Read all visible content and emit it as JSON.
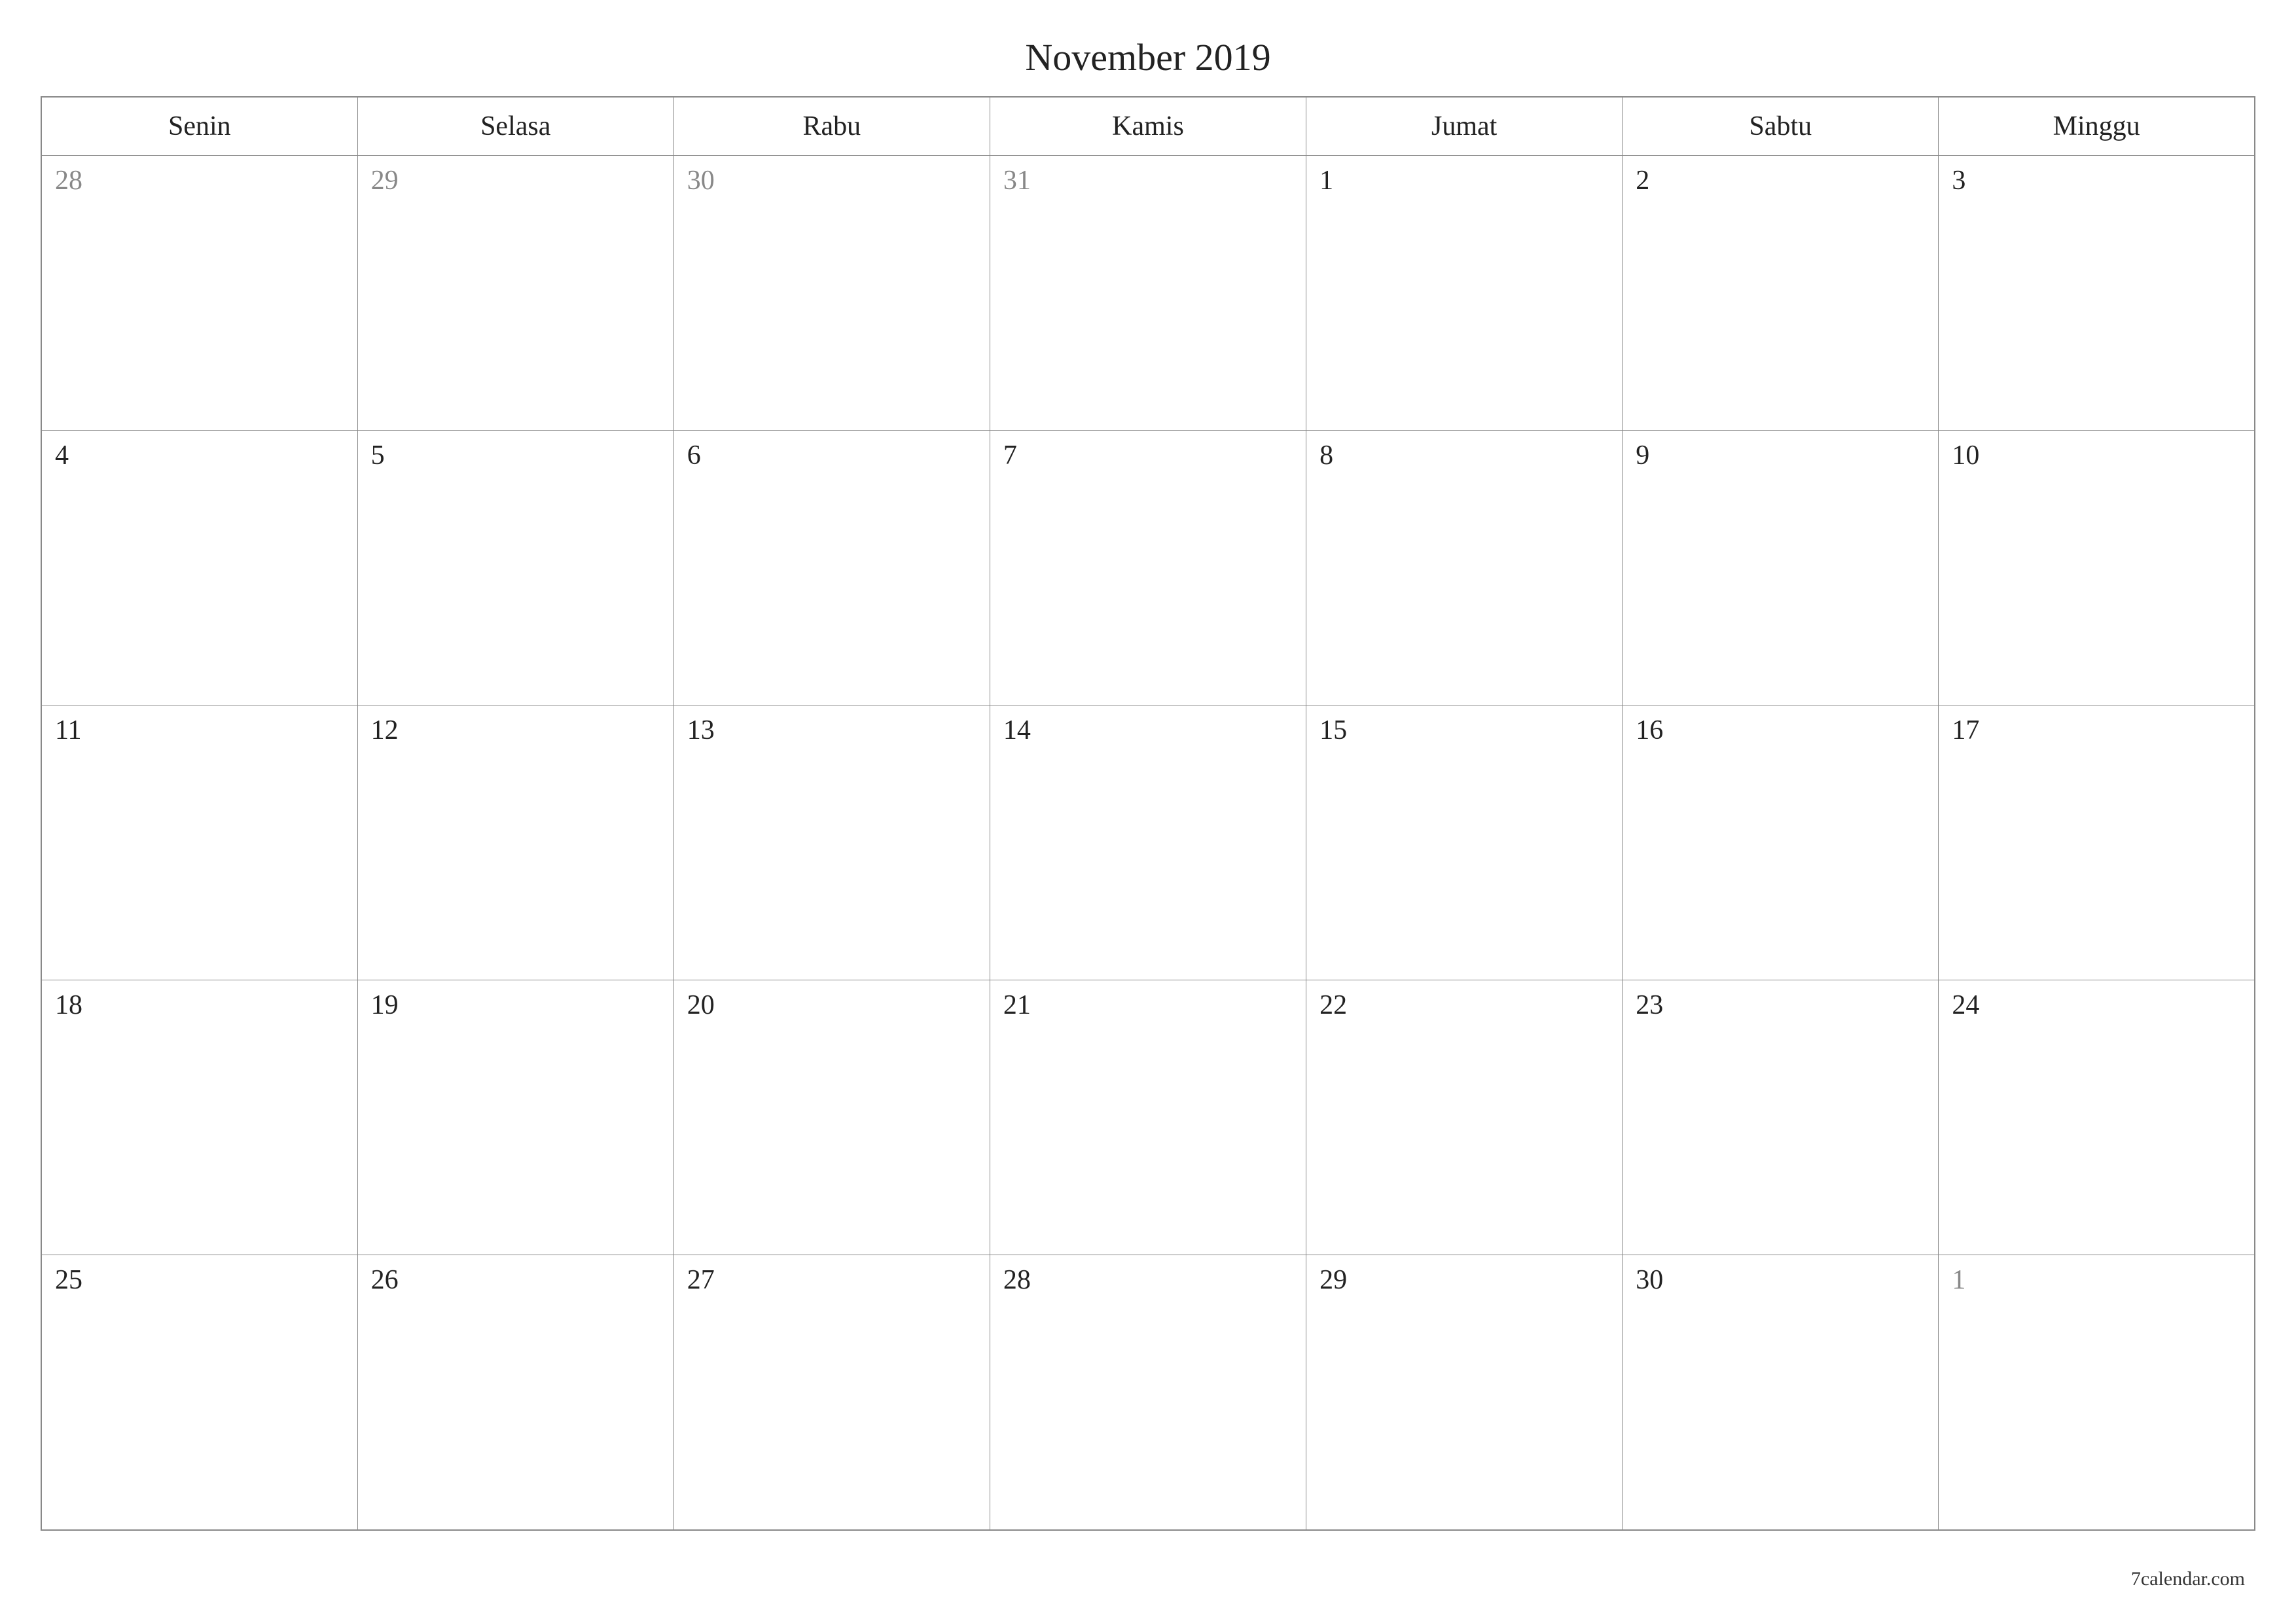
{
  "calendar": {
    "title": "November 2019",
    "weekdays": [
      "Senin",
      "Selasa",
      "Rabu",
      "Kamis",
      "Jumat",
      "Sabtu",
      "Minggu"
    ],
    "weeks": [
      [
        {
          "day": "28",
          "other": true
        },
        {
          "day": "29",
          "other": true
        },
        {
          "day": "30",
          "other": true
        },
        {
          "day": "31",
          "other": true
        },
        {
          "day": "1",
          "other": false
        },
        {
          "day": "2",
          "other": false
        },
        {
          "day": "3",
          "other": false
        }
      ],
      [
        {
          "day": "4",
          "other": false
        },
        {
          "day": "5",
          "other": false
        },
        {
          "day": "6",
          "other": false
        },
        {
          "day": "7",
          "other": false
        },
        {
          "day": "8",
          "other": false
        },
        {
          "day": "9",
          "other": false
        },
        {
          "day": "10",
          "other": false
        }
      ],
      [
        {
          "day": "11",
          "other": false
        },
        {
          "day": "12",
          "other": false
        },
        {
          "day": "13",
          "other": false
        },
        {
          "day": "14",
          "other": false
        },
        {
          "day": "15",
          "other": false
        },
        {
          "day": "16",
          "other": false
        },
        {
          "day": "17",
          "other": false
        }
      ],
      [
        {
          "day": "18",
          "other": false
        },
        {
          "day": "19",
          "other": false
        },
        {
          "day": "20",
          "other": false
        },
        {
          "day": "21",
          "other": false
        },
        {
          "day": "22",
          "other": false
        },
        {
          "day": "23",
          "other": false
        },
        {
          "day": "24",
          "other": false
        }
      ],
      [
        {
          "day": "25",
          "other": false
        },
        {
          "day": "26",
          "other": false
        },
        {
          "day": "27",
          "other": false
        },
        {
          "day": "28",
          "other": false
        },
        {
          "day": "29",
          "other": false
        },
        {
          "day": "30",
          "other": false
        },
        {
          "day": "1",
          "other": true
        }
      ]
    ]
  },
  "footer": {
    "credit": "7calendar.com"
  }
}
